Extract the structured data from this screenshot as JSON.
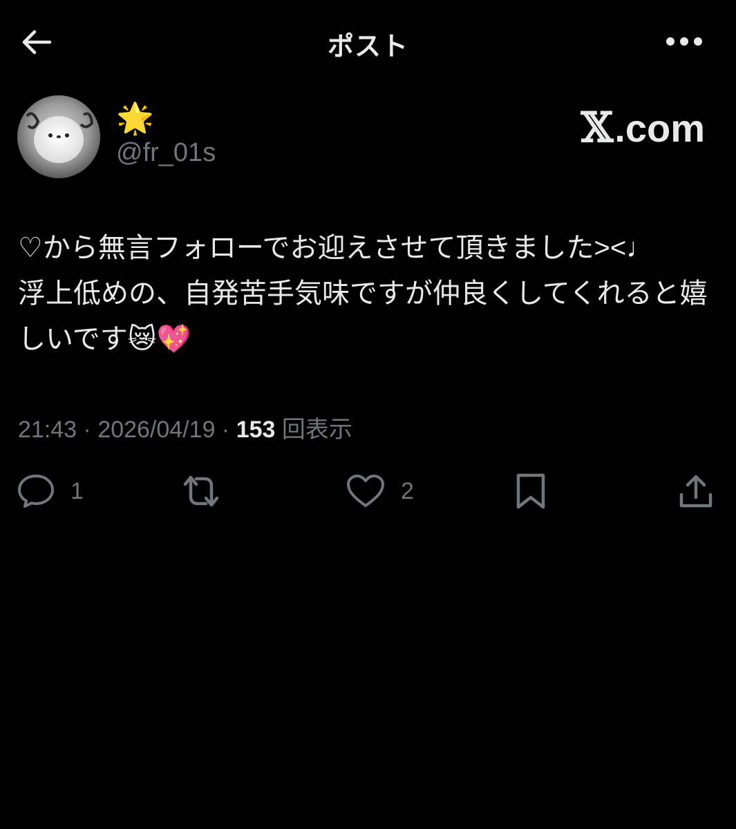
{
  "header": {
    "title": "ポスト",
    "back_icon": "arrow-left-icon",
    "more_icon": "more-horizontal-icon"
  },
  "author": {
    "display_name": "🌟",
    "handle": "@fr_01s",
    "avatar_icon": "avatar-image"
  },
  "brand": {
    "logo": "𝕏",
    "suffix": ".com"
  },
  "post": {
    "text": "♡から無言フォローでお迎えさせて頂きました><♩\n浮上低めの、自発苦手気味ですが仲良くしてくれると嬉しいです😿💖"
  },
  "meta": {
    "time": "21:43",
    "separator": " · ",
    "date": "2026/04/19",
    "views_count": "153",
    "views_label": "回表示"
  },
  "actions": {
    "reply_count": "1",
    "like_count": "2"
  },
  "colors": {
    "background": "#000000",
    "text": "#e7e9ea",
    "secondary": "#71767b"
  }
}
